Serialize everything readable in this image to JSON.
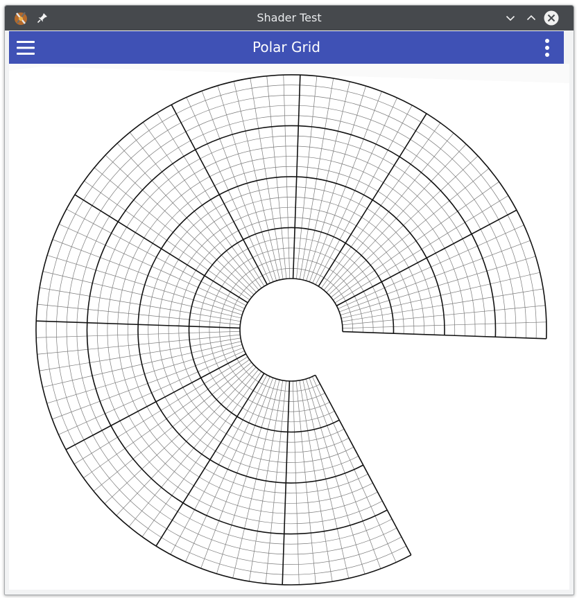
{
  "window": {
    "title": "Shader Test",
    "app_icon": "krita-icon",
    "pin_icon": "pin-icon",
    "controls": [
      "minimize-icon",
      "maximize-icon",
      "close-icon"
    ],
    "colors": {
      "titlebar": "#46494d",
      "frame": "#a8abae"
    }
  },
  "toolbar": {
    "title": "Polar Grid",
    "menu_icon": "hamburger-menu-icon",
    "overflow_icon": "overflow-menu-icon",
    "colors": {
      "background": "#3f51b5",
      "text": "#ffffff"
    }
  },
  "canvas": {
    "background": "#ffffff",
    "grid": {
      "rings_major": 5,
      "spokes_major": 12,
      "minor_per_major_angular": 8,
      "minor_per_major_radial": 5,
      "opening_degrees": 60,
      "major_color": "#111111",
      "minor_color": "#7a7a7a"
    }
  }
}
